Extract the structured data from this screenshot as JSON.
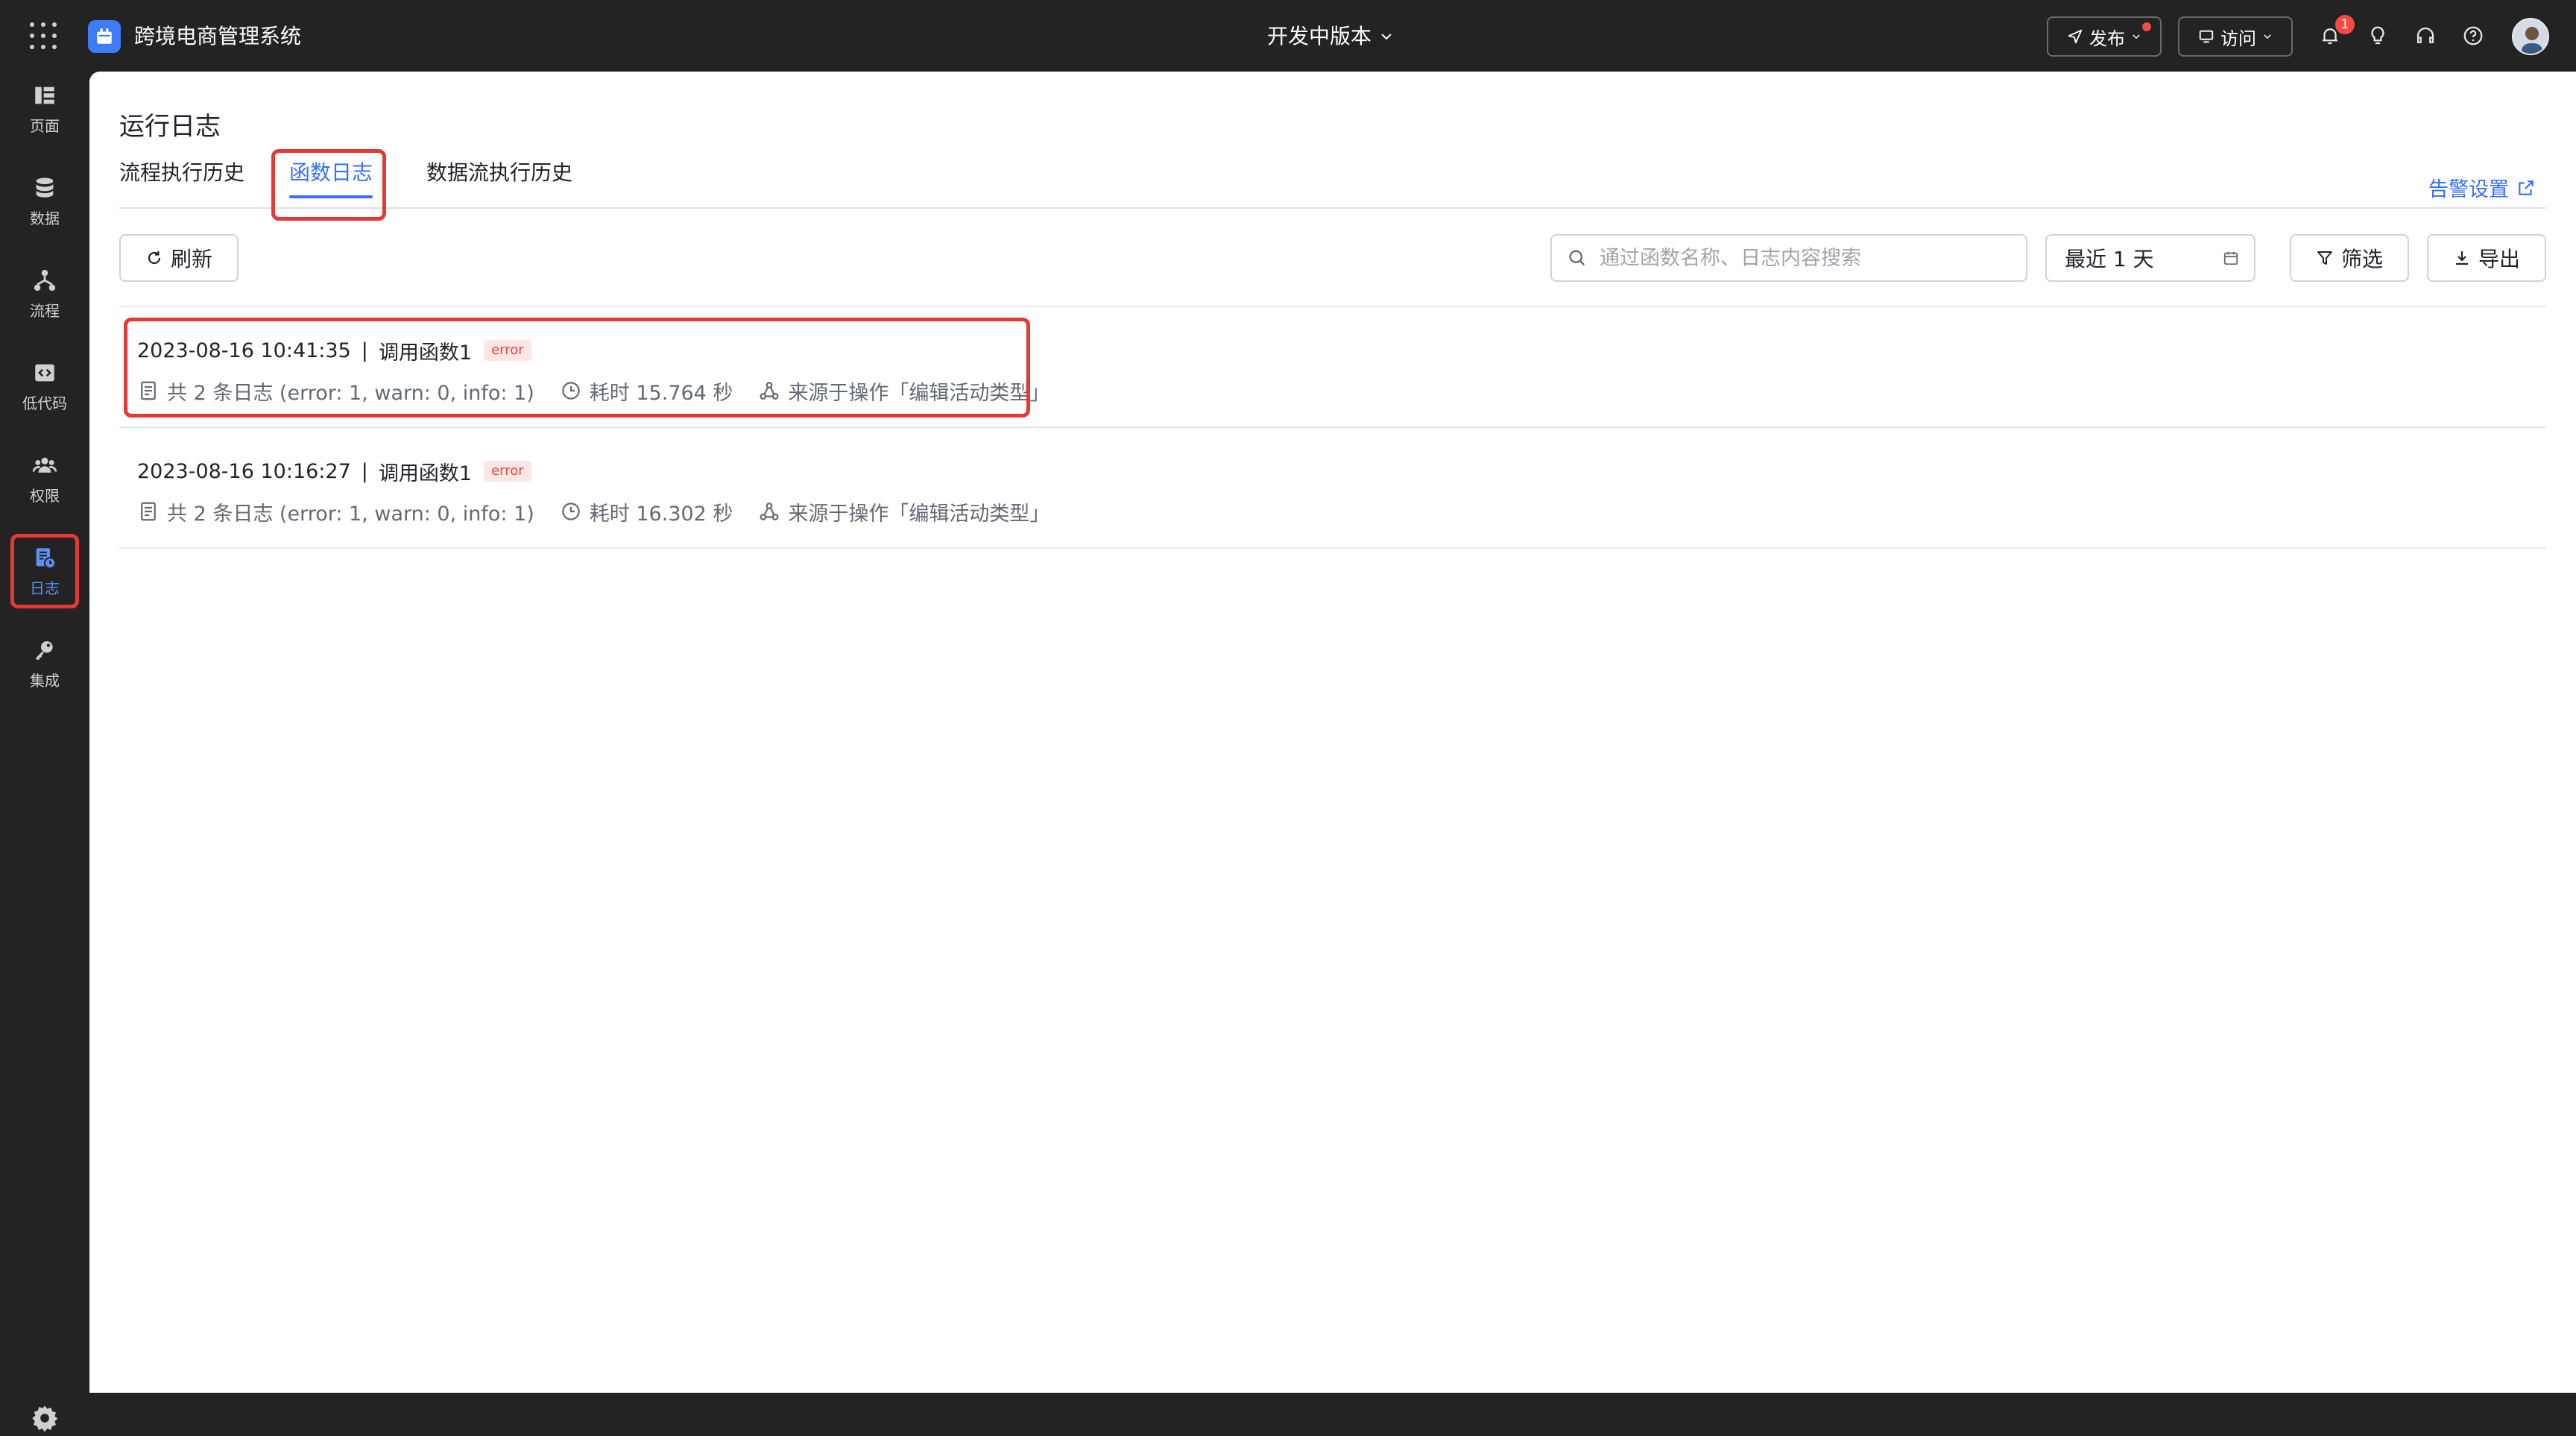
{
  "topbar": {
    "app_name": "跨境电商管理系统",
    "version": "开发中版本",
    "publish_label": "发布",
    "visit_label": "访问",
    "notification_count": "1"
  },
  "sidenav": {
    "items": [
      {
        "label": "页面",
        "icon": "page-icon"
      },
      {
        "label": "数据",
        "icon": "database-icon"
      },
      {
        "label": "流程",
        "icon": "flow-icon"
      },
      {
        "label": "低代码",
        "icon": "code-icon"
      },
      {
        "label": "权限",
        "icon": "users-icon"
      },
      {
        "label": "日志",
        "icon": "log-icon"
      },
      {
        "label": "集成",
        "icon": "key-icon"
      }
    ],
    "active_index": 5
  },
  "page": {
    "title": "运行日志",
    "tabs": [
      "流程执行历史",
      "函数日志",
      "数据流执行历史"
    ],
    "active_tab": 1,
    "alert_settings": "告警设置"
  },
  "toolbar": {
    "refresh_label": "刷新",
    "search_placeholder": "通过函数名称、日志内容搜索",
    "date_range": "最近 1 天",
    "filter_label": "筛选",
    "export_label": "导出"
  },
  "logs": [
    {
      "time": "2023-08-16 10:41:35",
      "function": "调用函数1",
      "level": "error",
      "summary": "共 2 条日志 (error: 1, warn: 0, info: 1)",
      "duration": "耗时 15.764 秒",
      "source": "来源于操作「编辑活动类型」"
    },
    {
      "time": "2023-08-16 10:16:27",
      "function": "调用函数1",
      "level": "error",
      "summary": "共 2 条日志 (error: 1, warn: 0, info: 1)",
      "duration": "耗时 16.302 秒",
      "source": "来源于操作「编辑活动类型」"
    }
  ],
  "colors": {
    "accent": "#3370ff",
    "error": "#e5483f",
    "highlight": "#e53935",
    "dark_bg": "#232323"
  }
}
